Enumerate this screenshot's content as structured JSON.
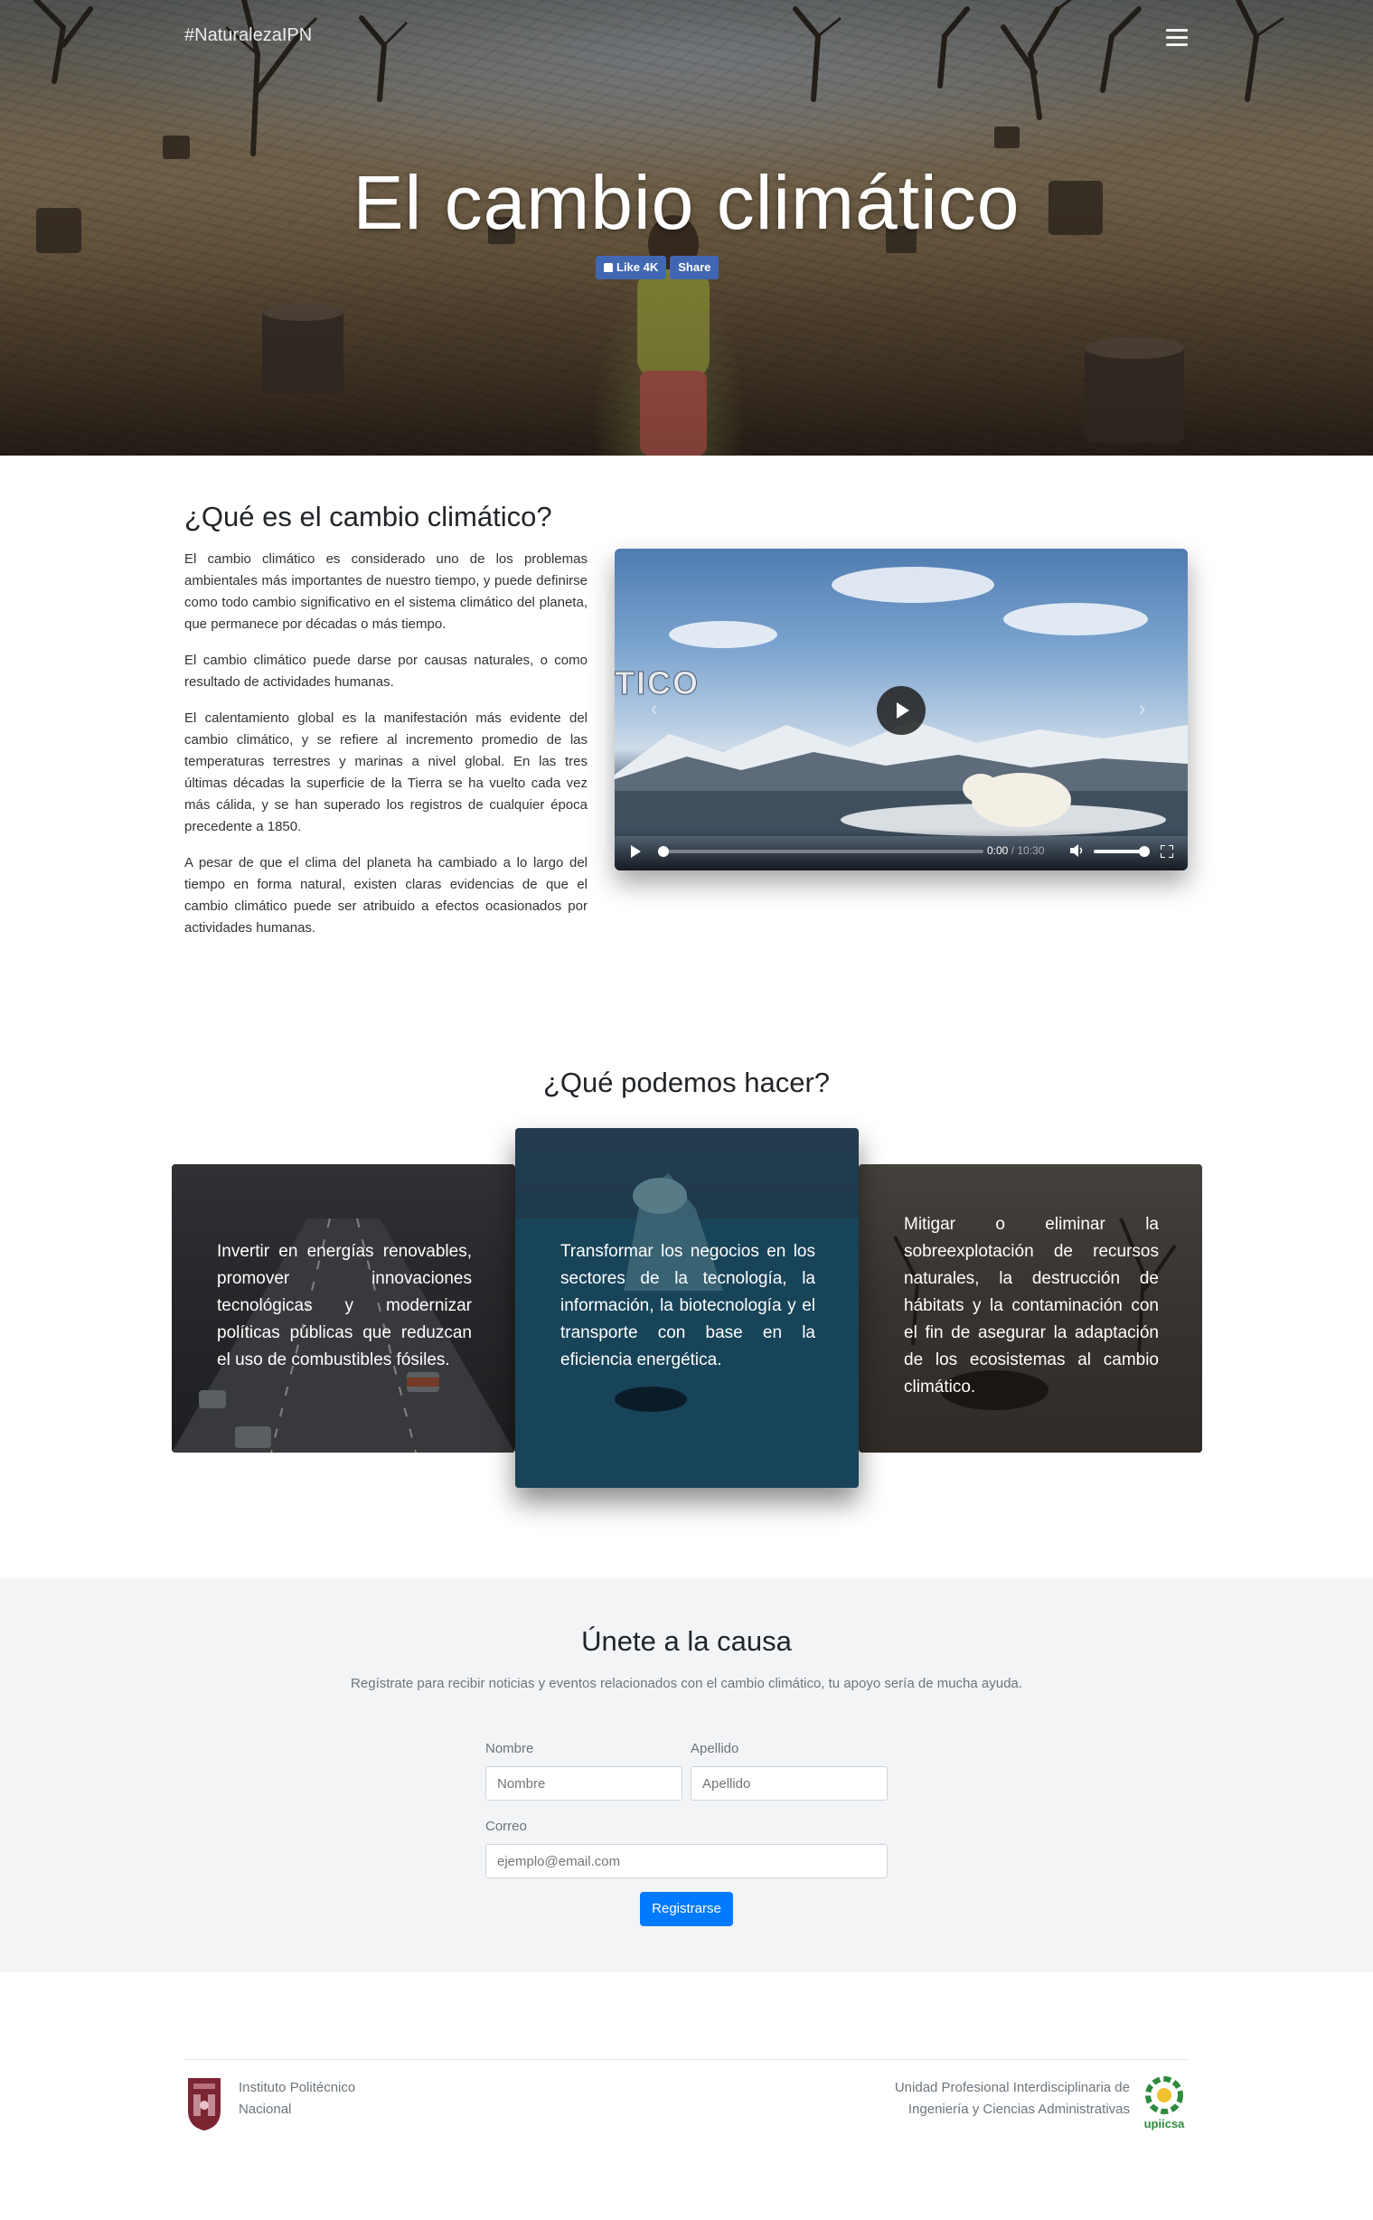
{
  "navbar": {
    "brand": "#NaturalezaIPN",
    "menu_icon": "hamburger-icon"
  },
  "hero": {
    "title": "El cambio climático",
    "like_label": "Like 4K",
    "share_label": "Share"
  },
  "about": {
    "heading": "¿Qué es el cambio climático?",
    "paragraphs": [
      "El cambio climático es considerado uno de los problemas ambientales más importantes de nuestro tiempo, y puede definirse como todo cambio significativo en el sistema climático del planeta, que permanece por décadas o más tiempo.",
      "El cambio climático puede darse por causas naturales, o como resultado de actividades humanas.",
      "El calentamiento global es la manifestación más evidente del cambio climático, y se refiere al incremento promedio de las temperaturas terrestres y marinas a nivel global. En las tres últimas décadas la superficie de la Tierra se ha vuelto cada vez más cálida, y se han superado los registros de cualquier época precedente a 1850.",
      "A pesar de que el clima del planeta ha cambiado a lo largo del tiempo en forma natural, existen claras evidencias de que el cambio climático puede ser atribuido a efectos ocasionados por actividades humanas."
    ],
    "video": {
      "overlay_text": "TICO",
      "current_time": "0:00",
      "duration": "10:30",
      "progress": 0,
      "volume": 1
    }
  },
  "actions": {
    "heading": "¿Qué podemos hacer?",
    "cards": [
      "Invertir en energías renovables, promover innovaciones tecnológicas y modernizar políticas públicas que reduzcan el uso de combustibles fósiles.",
      "Transformar los negocios en los sectores de la tecnología, la información, la biotecnología y el transporte con base en la eficiencia energética.",
      "Mitigar o eliminar la sobreexplotación de recursos naturales, la destrucción de hábitats y la contaminación con el fin de asegurar la adaptación de los ecosistemas al cambio climático."
    ]
  },
  "signup": {
    "heading": "Únete a la causa",
    "subtitle": "Regístrate para recibir noticias y eventos relacionados con el cambio climático, tu apoyo sería de mucha ayuda.",
    "first_name_label": "Nombre",
    "first_name_placeholder": "Nombre",
    "last_name_label": "Apellido",
    "last_name_placeholder": "Apellido",
    "email_label": "Correo",
    "email_placeholder": "ejemplo@email.com",
    "submit_label": "Registrarse",
    "accent_color": "#007bff"
  },
  "footer": {
    "left_line1": "Instituto Politécnico",
    "left_line2": "Nacional",
    "right_line1": "Unidad Profesional Interdisciplinaria de",
    "right_line2": "Ingeniería y Ciencias Administrativas",
    "right_logo_text": "upiicsa"
  }
}
